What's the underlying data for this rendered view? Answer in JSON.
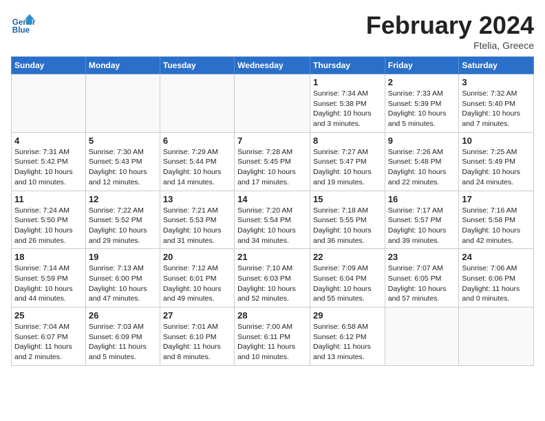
{
  "header": {
    "logo_text_general": "General",
    "logo_text_blue": "Blue",
    "month_title": "February 2024",
    "subtitle": "Ftelia, Greece"
  },
  "weekdays": [
    "Sunday",
    "Monday",
    "Tuesday",
    "Wednesday",
    "Thursday",
    "Friday",
    "Saturday"
  ],
  "weeks": [
    [
      {
        "day": "",
        "info": ""
      },
      {
        "day": "",
        "info": ""
      },
      {
        "day": "",
        "info": ""
      },
      {
        "day": "",
        "info": ""
      },
      {
        "day": "1",
        "info": "Sunrise: 7:34 AM\nSunset: 5:38 PM\nDaylight: 10 hours\nand 3 minutes."
      },
      {
        "day": "2",
        "info": "Sunrise: 7:33 AM\nSunset: 5:39 PM\nDaylight: 10 hours\nand 5 minutes."
      },
      {
        "day": "3",
        "info": "Sunrise: 7:32 AM\nSunset: 5:40 PM\nDaylight: 10 hours\nand 7 minutes."
      }
    ],
    [
      {
        "day": "4",
        "info": "Sunrise: 7:31 AM\nSunset: 5:42 PM\nDaylight: 10 hours\nand 10 minutes."
      },
      {
        "day": "5",
        "info": "Sunrise: 7:30 AM\nSunset: 5:43 PM\nDaylight: 10 hours\nand 12 minutes."
      },
      {
        "day": "6",
        "info": "Sunrise: 7:29 AM\nSunset: 5:44 PM\nDaylight: 10 hours\nand 14 minutes."
      },
      {
        "day": "7",
        "info": "Sunrise: 7:28 AM\nSunset: 5:45 PM\nDaylight: 10 hours\nand 17 minutes."
      },
      {
        "day": "8",
        "info": "Sunrise: 7:27 AM\nSunset: 5:47 PM\nDaylight: 10 hours\nand 19 minutes."
      },
      {
        "day": "9",
        "info": "Sunrise: 7:26 AM\nSunset: 5:48 PM\nDaylight: 10 hours\nand 22 minutes."
      },
      {
        "day": "10",
        "info": "Sunrise: 7:25 AM\nSunset: 5:49 PM\nDaylight: 10 hours\nand 24 minutes."
      }
    ],
    [
      {
        "day": "11",
        "info": "Sunrise: 7:24 AM\nSunset: 5:50 PM\nDaylight: 10 hours\nand 26 minutes."
      },
      {
        "day": "12",
        "info": "Sunrise: 7:22 AM\nSunset: 5:52 PM\nDaylight: 10 hours\nand 29 minutes."
      },
      {
        "day": "13",
        "info": "Sunrise: 7:21 AM\nSunset: 5:53 PM\nDaylight: 10 hours\nand 31 minutes."
      },
      {
        "day": "14",
        "info": "Sunrise: 7:20 AM\nSunset: 5:54 PM\nDaylight: 10 hours\nand 34 minutes."
      },
      {
        "day": "15",
        "info": "Sunrise: 7:18 AM\nSunset: 5:55 PM\nDaylight: 10 hours\nand 36 minutes."
      },
      {
        "day": "16",
        "info": "Sunrise: 7:17 AM\nSunset: 5:57 PM\nDaylight: 10 hours\nand 39 minutes."
      },
      {
        "day": "17",
        "info": "Sunrise: 7:16 AM\nSunset: 5:58 PM\nDaylight: 10 hours\nand 42 minutes."
      }
    ],
    [
      {
        "day": "18",
        "info": "Sunrise: 7:14 AM\nSunset: 5:59 PM\nDaylight: 10 hours\nand 44 minutes."
      },
      {
        "day": "19",
        "info": "Sunrise: 7:13 AM\nSunset: 6:00 PM\nDaylight: 10 hours\nand 47 minutes."
      },
      {
        "day": "20",
        "info": "Sunrise: 7:12 AM\nSunset: 6:01 PM\nDaylight: 10 hours\nand 49 minutes."
      },
      {
        "day": "21",
        "info": "Sunrise: 7:10 AM\nSunset: 6:03 PM\nDaylight: 10 hours\nand 52 minutes."
      },
      {
        "day": "22",
        "info": "Sunrise: 7:09 AM\nSunset: 6:04 PM\nDaylight: 10 hours\nand 55 minutes."
      },
      {
        "day": "23",
        "info": "Sunrise: 7:07 AM\nSunset: 6:05 PM\nDaylight: 10 hours\nand 57 minutes."
      },
      {
        "day": "24",
        "info": "Sunrise: 7:06 AM\nSunset: 6:06 PM\nDaylight: 11 hours\nand 0 minutes."
      }
    ],
    [
      {
        "day": "25",
        "info": "Sunrise: 7:04 AM\nSunset: 6:07 PM\nDaylight: 11 hours\nand 2 minutes."
      },
      {
        "day": "26",
        "info": "Sunrise: 7:03 AM\nSunset: 6:09 PM\nDaylight: 11 hours\nand 5 minutes."
      },
      {
        "day": "27",
        "info": "Sunrise: 7:01 AM\nSunset: 6:10 PM\nDaylight: 11 hours\nand 8 minutes."
      },
      {
        "day": "28",
        "info": "Sunrise: 7:00 AM\nSunset: 6:11 PM\nDaylight: 11 hours\nand 10 minutes."
      },
      {
        "day": "29",
        "info": "Sunrise: 6:58 AM\nSunset: 6:12 PM\nDaylight: 11 hours\nand 13 minutes."
      },
      {
        "day": "",
        "info": ""
      },
      {
        "day": "",
        "info": ""
      }
    ]
  ]
}
